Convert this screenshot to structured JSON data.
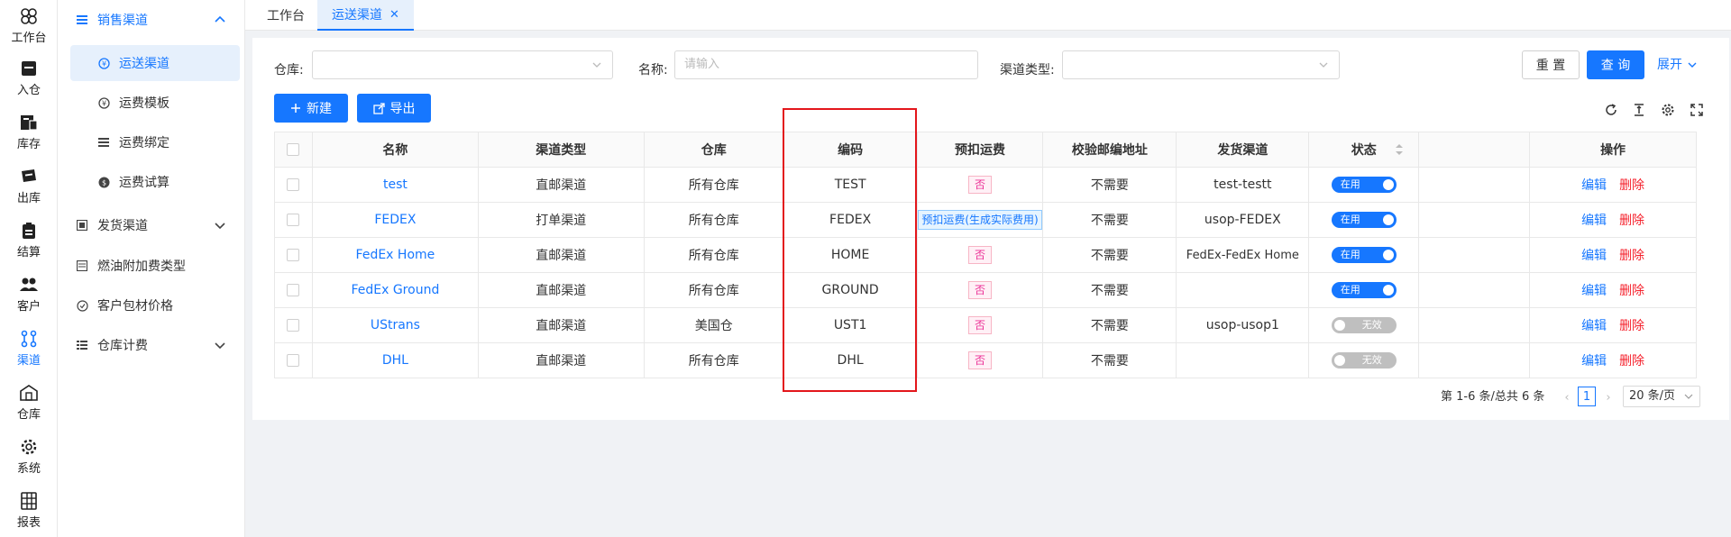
{
  "rail": [
    {
      "label": "工作台",
      "icon": "workbench-icon"
    },
    {
      "label": "入仓",
      "icon": "inbound-icon"
    },
    {
      "label": "库存",
      "icon": "inventory-icon"
    },
    {
      "label": "出库",
      "icon": "outbound-icon"
    },
    {
      "label": "结算",
      "icon": "settlement-icon"
    },
    {
      "label": "客户",
      "icon": "customer-icon"
    },
    {
      "label": "渠道",
      "icon": "channel-icon"
    },
    {
      "label": "仓库",
      "icon": "warehouse-icon"
    },
    {
      "label": "系统",
      "icon": "gear-icon"
    },
    {
      "label": "报表",
      "icon": "report-icon"
    }
  ],
  "menu": {
    "sales_channel": "销售渠道",
    "shipping_channel": "运送渠道",
    "freight_template": "运费模板",
    "freight_binding": "运费绑定",
    "freight_trial": "运费试算",
    "delivery_channel": "发货渠道",
    "fuel_surcharge": "燃油附加费类型",
    "customer_packaging": "客户包材价格",
    "warehouse_billing": "仓库计费"
  },
  "tabs": {
    "workbench": "工作台",
    "shipping_channel": "运送渠道",
    "close": "✕"
  },
  "filters": {
    "warehouse_label": "仓库:",
    "name_label": "名称:",
    "name_placeholder": "请输入",
    "channel_type_label": "渠道类型:",
    "reset": "重 置",
    "query": "查 询",
    "expand": "展开"
  },
  "actions": {
    "new": "新建",
    "export": "导出"
  },
  "table": {
    "headers": {
      "name": "名称",
      "channel_type": "渠道类型",
      "warehouse": "仓库",
      "code": "编码",
      "prepay": "预扣运费",
      "check_zip": "校验邮编地址",
      "delivery": "发货渠道",
      "status": "状态",
      "operation": "操作"
    },
    "edit": "编辑",
    "delete": "删除",
    "rows": [
      {
        "name": "test",
        "type": "直邮渠道",
        "warehouse": "所有仓库",
        "code": "TEST",
        "prepay": "否",
        "check": "不需要",
        "delivery": "test-testt",
        "status": "在用"
      },
      {
        "name": "FEDEX",
        "type": "打单渠道",
        "warehouse": "所有仓库",
        "code": "FEDEX",
        "prepay": "预扣运费(生成实际费用)",
        "check": "不需要",
        "delivery": "usop-FEDEX",
        "status": "在用"
      },
      {
        "name": "FedEx Home",
        "type": "直邮渠道",
        "warehouse": "所有仓库",
        "code": "HOME",
        "prepay": "否",
        "check": "不需要",
        "delivery": "FedEx-FedEx Home",
        "status": "在用"
      },
      {
        "name": "FedEx Ground",
        "type": "直邮渠道",
        "warehouse": "所有仓库",
        "code": "GROUND",
        "prepay": "否",
        "check": "不需要",
        "delivery": "",
        "status": "在用"
      },
      {
        "name": "UStrans",
        "type": "直邮渠道",
        "warehouse": "美国仓",
        "code": "UST1",
        "prepay": "否",
        "check": "不需要",
        "delivery": "usop-usop1",
        "status": "无效"
      },
      {
        "name": "DHL",
        "type": "直邮渠道",
        "warehouse": "所有仓库",
        "code": "DHL",
        "prepay": "否",
        "check": "不需要",
        "delivery": "",
        "status": "无效"
      }
    ]
  },
  "pagination": {
    "total": "第 1-6 条/总共 6 条",
    "page": "1",
    "page_size": "20 条/页"
  },
  "colors": {
    "primary": "#1677ff",
    "danger": "#f5222d",
    "highlight": "#e3161b"
  }
}
